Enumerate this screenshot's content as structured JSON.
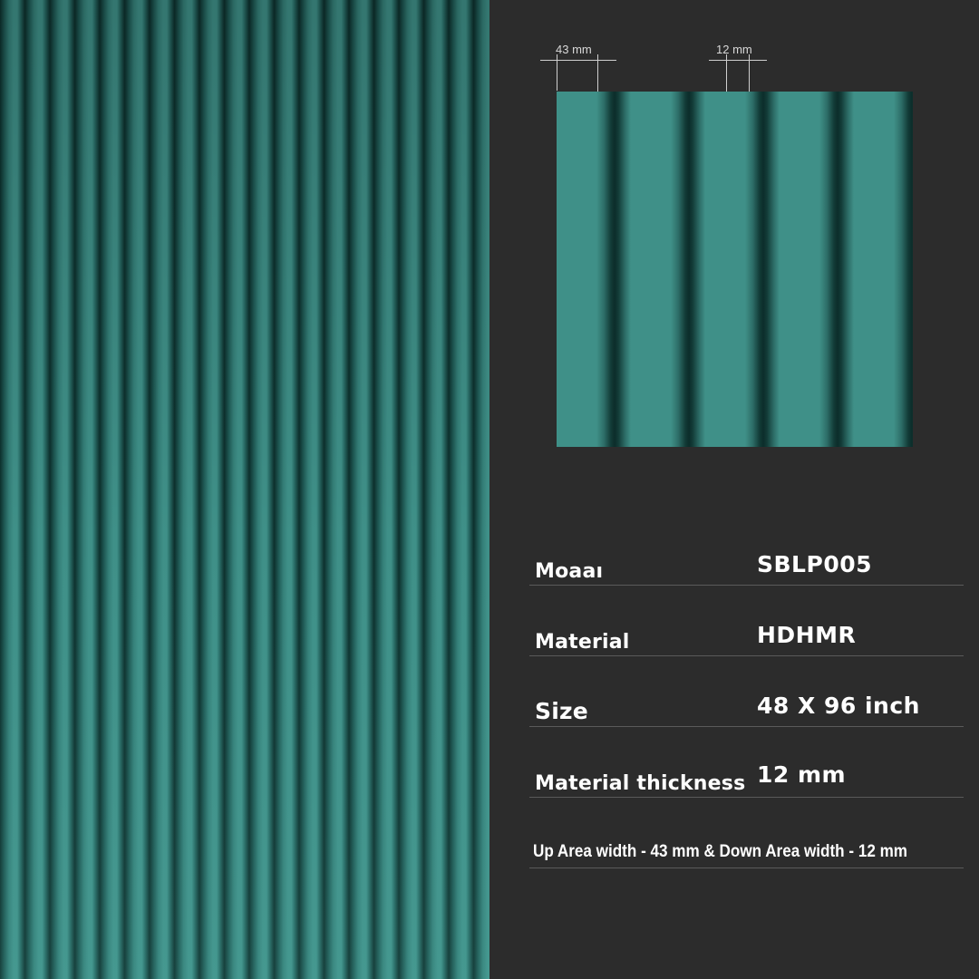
{
  "dimensions": {
    "up_width_label": "43 mm",
    "down_width_label": "12 mm"
  },
  "specs": [
    {
      "label": "Moaaı",
      "value": "SBLP005"
    },
    {
      "label": "Material",
      "value": "HDHMR"
    },
    {
      "label": "Size",
      "value": "48 X 96 inch"
    },
    {
      "label": "Material thickness",
      "value": "12 mm"
    }
  ],
  "note": "Up Area width - 43 mm & Down Area width - 12 mm",
  "colors": {
    "background": "#2c2c2c",
    "panel_teal": "#3f9088",
    "groove_shadow": "#0d302d",
    "text": "#ffffff"
  }
}
